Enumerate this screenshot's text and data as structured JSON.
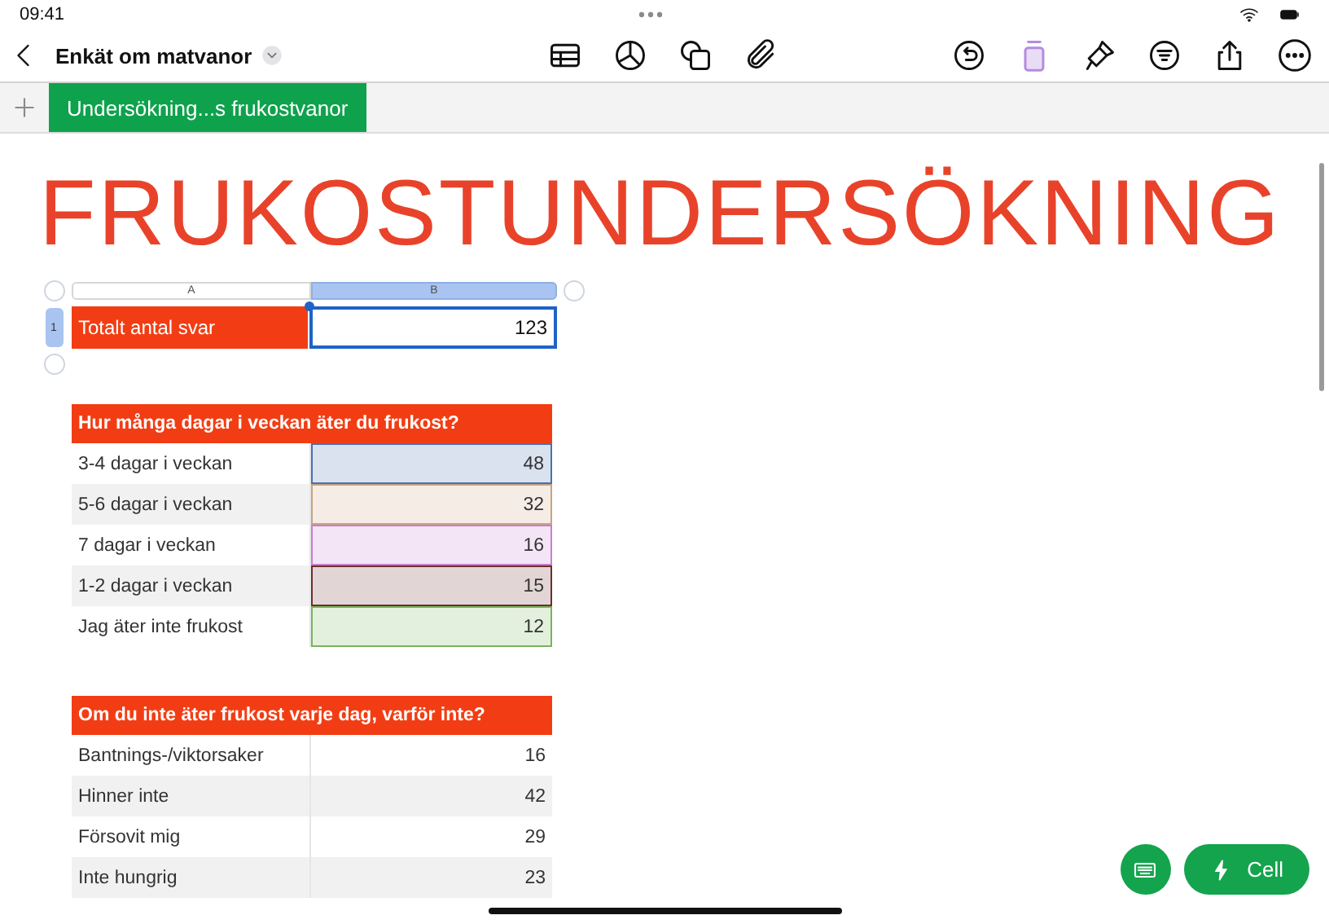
{
  "status_bar": {
    "time": "09:41"
  },
  "toolbar": {
    "document_title": "Enkät om matvanor"
  },
  "sheet_tabs": [
    {
      "label": "Undersökning...s frukostvanor",
      "selected": true
    }
  ],
  "title": "FRUKOSTUNDERSÖKNING",
  "summary_table": {
    "columns": [
      {
        "label": "A",
        "selected": false
      },
      {
        "label": "B",
        "selected": true
      }
    ],
    "row_number": "1",
    "label": "Totalt antal svar",
    "value": "123",
    "selected": true
  },
  "tables": [
    {
      "header": "Hur många dagar i veckan äter du frukost?",
      "rows": [
        {
          "label": "3-4 dagar i veckan",
          "value": "48",
          "color": "#4a6fb0"
        },
        {
          "label": "5-6 dagar i veckan",
          "value": "32",
          "color": "#c9a27f"
        },
        {
          "label": "7 dagar i veckan",
          "value": "16",
          "color": "#c77fd0"
        },
        {
          "label": "1-2 dagar i veckan",
          "value": "15",
          "color": "#6e2d2d"
        },
        {
          "label": "Jag äter inte frukost",
          "value": "12",
          "color": "#78b45a"
        }
      ]
    },
    {
      "header": "Om du inte äter frukost varje dag, varför inte?",
      "rows": [
        {
          "label": "Bantnings-/viktorsaker",
          "value": "16"
        },
        {
          "label": "Hinner inte",
          "value": "42"
        },
        {
          "label": "Försovit mig",
          "value": "29"
        },
        {
          "label": "Inte hungrig",
          "value": "23"
        }
      ]
    }
  ],
  "cell_button": {
    "label": "Cell"
  }
}
